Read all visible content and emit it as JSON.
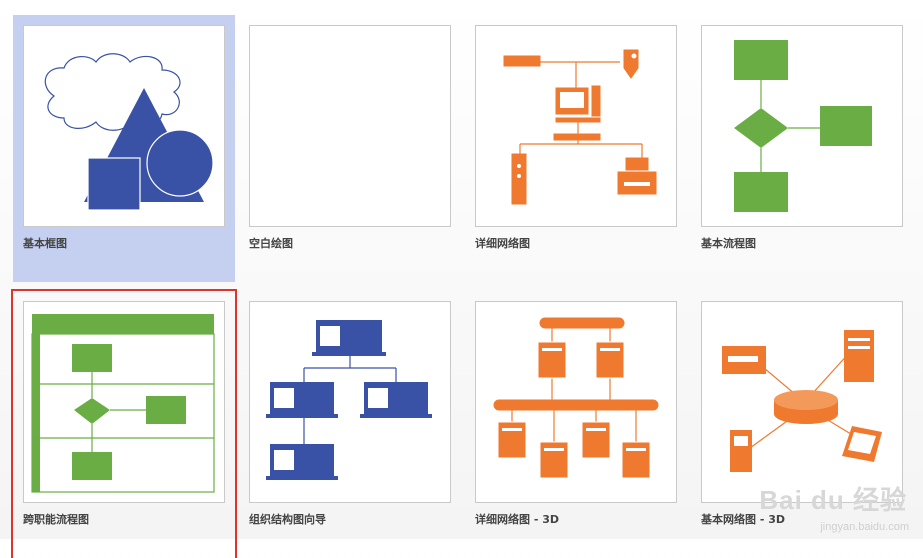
{
  "templates": [
    {
      "label": "基本框图",
      "selected": true
    },
    {
      "label": "空白绘图"
    },
    {
      "label": "详细网络图"
    },
    {
      "label": "基本流程图"
    },
    {
      "label": "跨职能流程图",
      "highlighted": true
    },
    {
      "label": "组织结构图向导"
    },
    {
      "label": "详细网络图 - 3D"
    },
    {
      "label": "基本网络图 - 3D"
    }
  ],
  "watermark": {
    "text": "Bai du 经验",
    "url": "jingyan.baidu.com"
  },
  "colors": {
    "shape_blue": "#3a52a5",
    "network_orange": "#ef7a2f",
    "flow_green": "#6aad45",
    "selection": "#c5cff0",
    "highlight_border": "#e0332e"
  }
}
